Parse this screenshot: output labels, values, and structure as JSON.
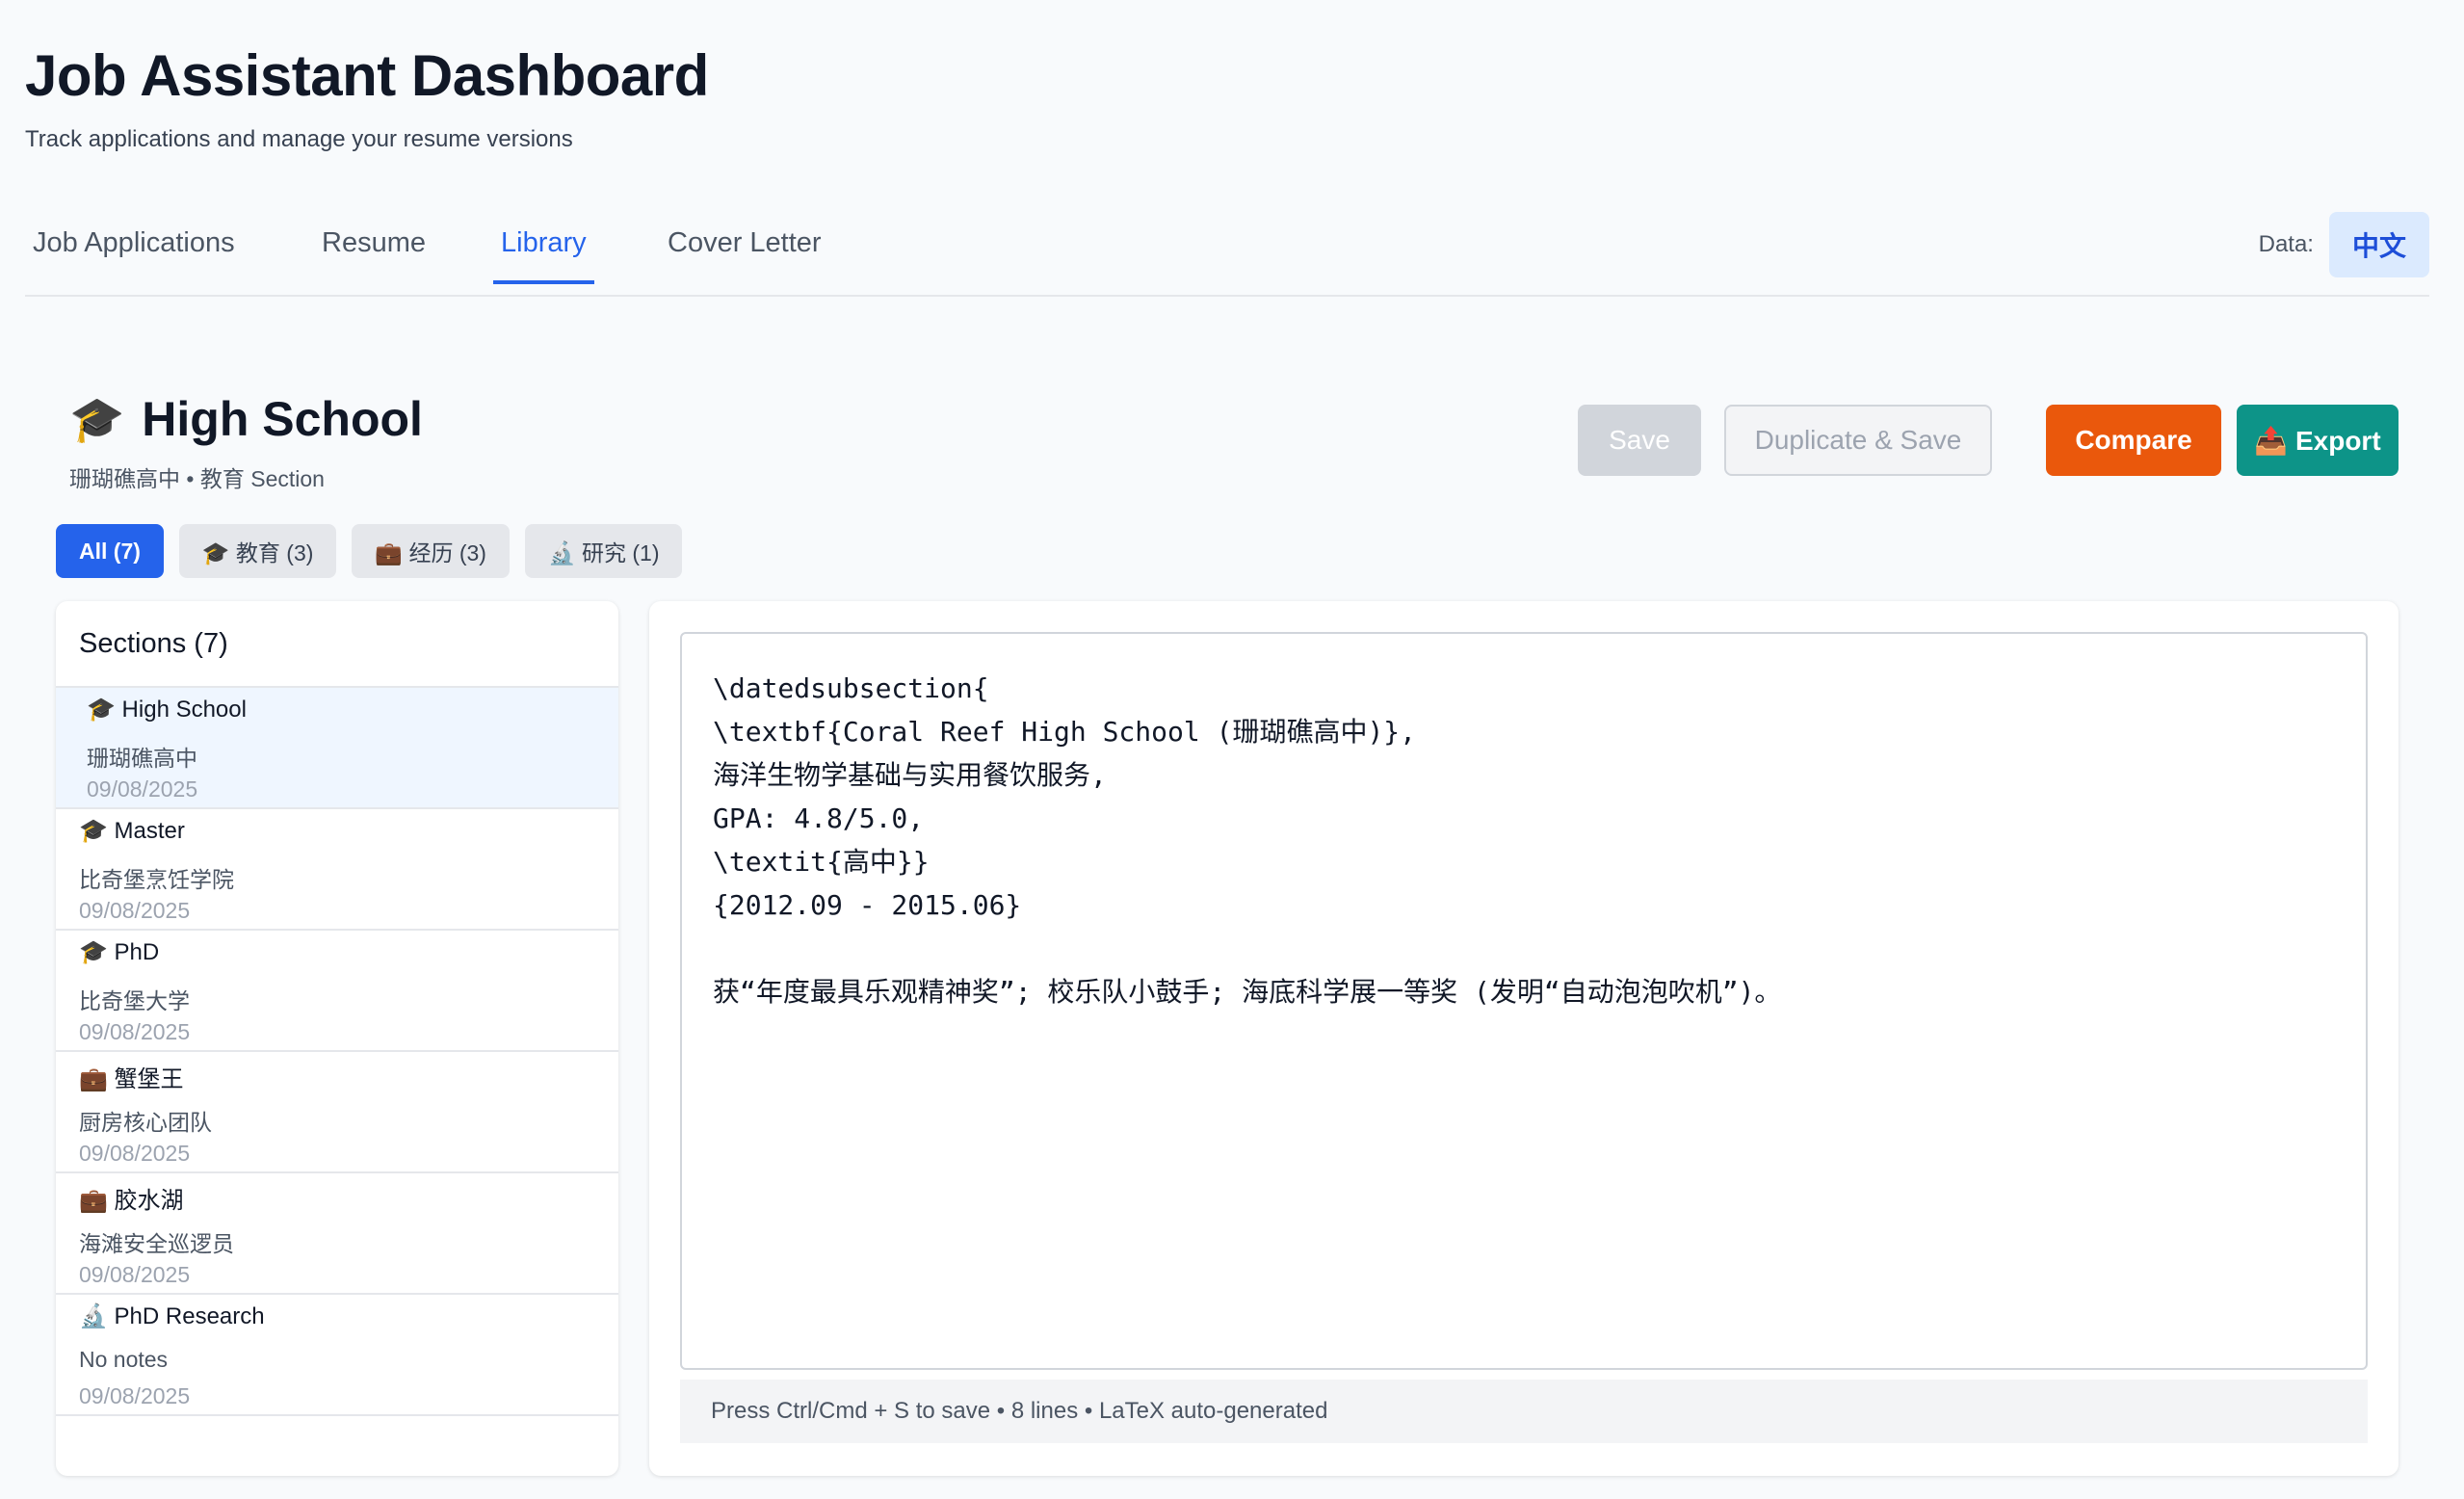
{
  "app": {
    "title": "Job Assistant Dashboard",
    "subtitle": "Track applications and manage your resume versions"
  },
  "tabs": [
    {
      "label": "Job Applications",
      "active": false
    },
    {
      "label": "Resume",
      "active": false
    },
    {
      "label": "Library",
      "active": true
    },
    {
      "label": "Cover Letter",
      "active": false
    }
  ],
  "language": {
    "label": "Data:",
    "value": "中文"
  },
  "section": {
    "icon": "🎓",
    "title": "High School",
    "meta": "珊瑚礁高中 • 教育 Section"
  },
  "actions": {
    "save": "Save",
    "duplicate": "Duplicate & Save",
    "compare": "Compare",
    "export": "📤 Export"
  },
  "filters": [
    {
      "label": "All (7)",
      "active": true
    },
    {
      "label": "🎓 教育 (3)",
      "active": false
    },
    {
      "label": "💼 经历 (3)",
      "active": false
    },
    {
      "label": "🔬 研究 (1)",
      "active": false
    }
  ],
  "sidebar": {
    "heading": "Sections (7)",
    "items": [
      {
        "title": "🎓 High School",
        "note": "珊瑚礁高中",
        "date": "09/08/2025",
        "selected": true
      },
      {
        "title": "🎓 Master",
        "note": "比奇堡烹饪学院",
        "date": "09/08/2025",
        "selected": false
      },
      {
        "title": "🎓 PhD",
        "note": "比奇堡大学",
        "date": "09/08/2025",
        "selected": false
      },
      {
        "title": "💼 蟹堡王",
        "note": "厨房核心团队",
        "date": "09/08/2025",
        "selected": false
      },
      {
        "title": "💼 胶水湖",
        "note": "海滩安全巡逻员",
        "date": "09/08/2025",
        "selected": false
      },
      {
        "title": "🔬 PhD Research",
        "note": "No notes",
        "date": "09/08/2025",
        "selected": false
      }
    ]
  },
  "editor": {
    "lines": [
      "\\datedsubsection{",
      "\\textbf{Coral Reef High School (珊瑚礁高中)},",
      "海洋生物学基础与实用餐饮服务,",
      "GPA: 4.8/5.0,",
      "\\textit{高中}}",
      "{2012.09 - 2015.06}",
      "",
      "获“年度最具乐观精神奖”; 校乐队小鼓手; 海底科学展一等奖 (发明“自动泡泡吹机”)。"
    ],
    "status": "Press Ctrl/Cmd + S to save • 8 lines • LaTeX auto-generated"
  }
}
